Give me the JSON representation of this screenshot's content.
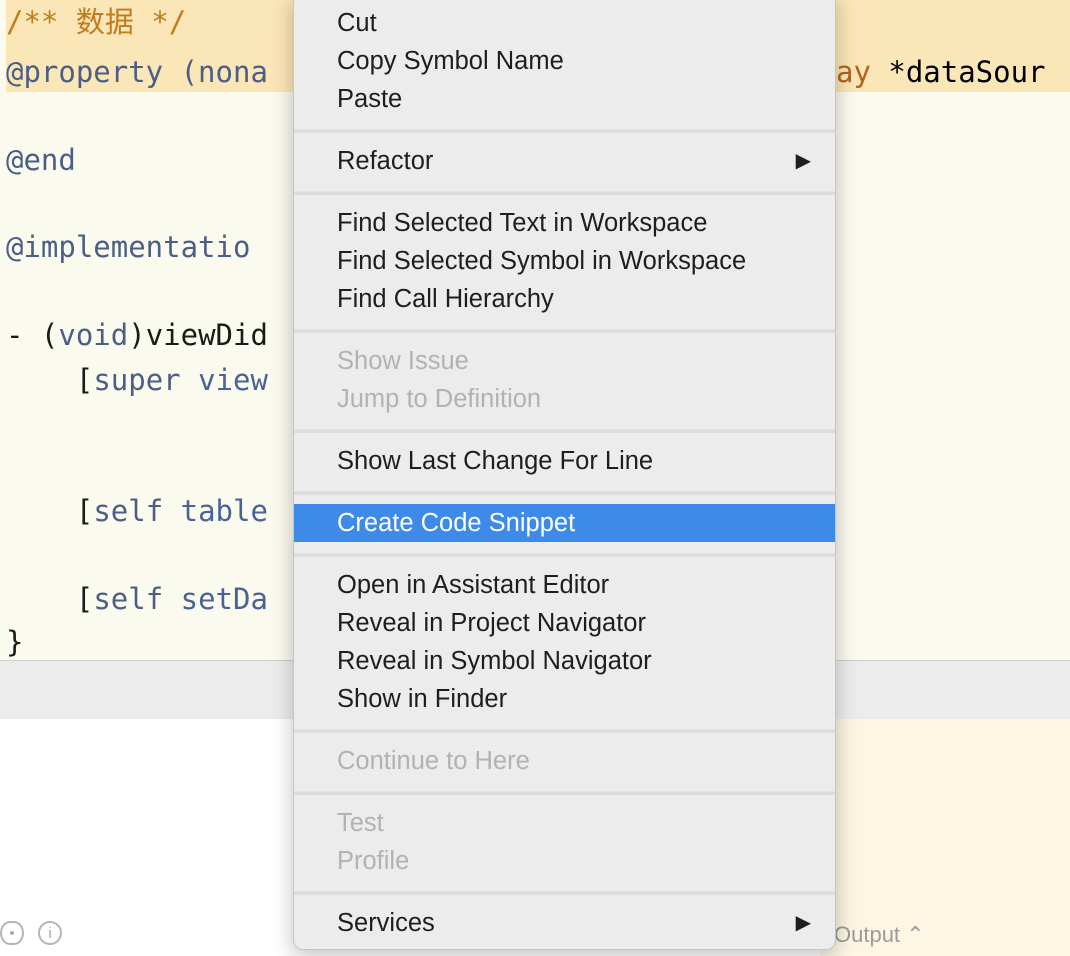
{
  "editor": {
    "lines": [
      {
        "text": "/** 数据 */"
      },
      {
        "prefix": "@property",
        "rest": " (nona"
      },
      {
        "text": "@end"
      },
      {
        "text": "@implementatio"
      },
      {
        "a": "- (",
        "b": "void",
        "c": ")viewDid"
      },
      {
        "a": "    [",
        "b": "super",
        "c": " ",
        "d": "view"
      },
      {
        "a": "    [",
        "b": "self",
        "c": " ",
        "d": "table"
      },
      {
        "a": "    [",
        "b": "self",
        "c": " ",
        "d": "setDa"
      },
      {
        "text": "}"
      }
    ],
    "right_fragment_a": "ay",
    "right_fragment_b": " *dataSour"
  },
  "debug": {
    "output_label": "Output",
    "output_chevron": "⌃"
  },
  "menu": {
    "cut": "Cut",
    "copy_symbol": "Copy Symbol Name",
    "paste": "Paste",
    "refactor": "Refactor",
    "find_selected_text": "Find Selected Text in Workspace",
    "find_selected_symbol": "Find Selected Symbol in Workspace",
    "find_call_hierarchy": "Find Call Hierarchy",
    "show_issue": "Show Issue",
    "jump_to_definition": "Jump to Definition",
    "show_last_change": "Show Last Change For Line",
    "create_code_snippet": "Create Code Snippet",
    "open_assistant": "Open in Assistant Editor",
    "reveal_project": "Reveal in Project Navigator",
    "reveal_symbol": "Reveal in Symbol Navigator",
    "show_in_finder": "Show in Finder",
    "continue_to_here": "Continue to Here",
    "test": "Test",
    "profile": "Profile",
    "services": "Services",
    "submenu_arrow": "▶"
  }
}
